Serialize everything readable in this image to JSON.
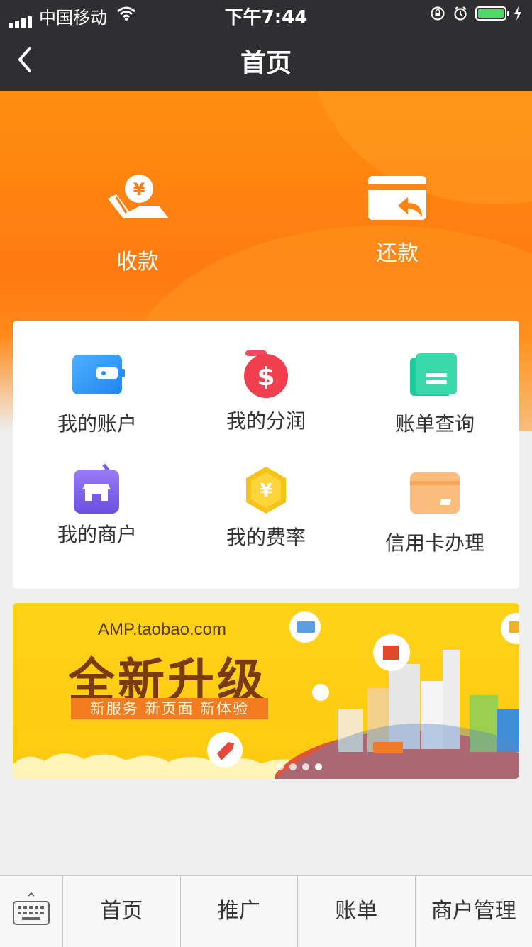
{
  "status_bar": {
    "carrier": "中国移动",
    "time": "下午7:44"
  },
  "nav": {
    "title": "首页"
  },
  "hero": {
    "actions": [
      {
        "label": "收款",
        "icon": "hand-yuan-icon"
      },
      {
        "label": "还款",
        "icon": "card-return-icon"
      }
    ]
  },
  "grid": {
    "items": [
      {
        "label": "我的账户",
        "icon": "wallet-icon"
      },
      {
        "label": "我的分润",
        "icon": "dollar-coin-icon"
      },
      {
        "label": "账单查询",
        "icon": "bill-icon"
      },
      {
        "label": "我的商户",
        "icon": "store-icon"
      },
      {
        "label": "我的费率",
        "icon": "yuan-hexagon-icon"
      },
      {
        "label": "信用卡办理",
        "icon": "credit-card-icon"
      }
    ]
  },
  "banner": {
    "url": "AMP.taobao.com",
    "headline": "全新升级",
    "tagline": "新服务 新页面 新体验"
  },
  "tabbar": {
    "items": [
      {
        "label": "首页"
      },
      {
        "label": "推广"
      },
      {
        "label": "账单"
      },
      {
        "label": "商户管理"
      }
    ]
  },
  "colors": {
    "accent": "#ff7a12",
    "navbar": "#2f2f31",
    "banner_bg": "#ffd21a"
  }
}
